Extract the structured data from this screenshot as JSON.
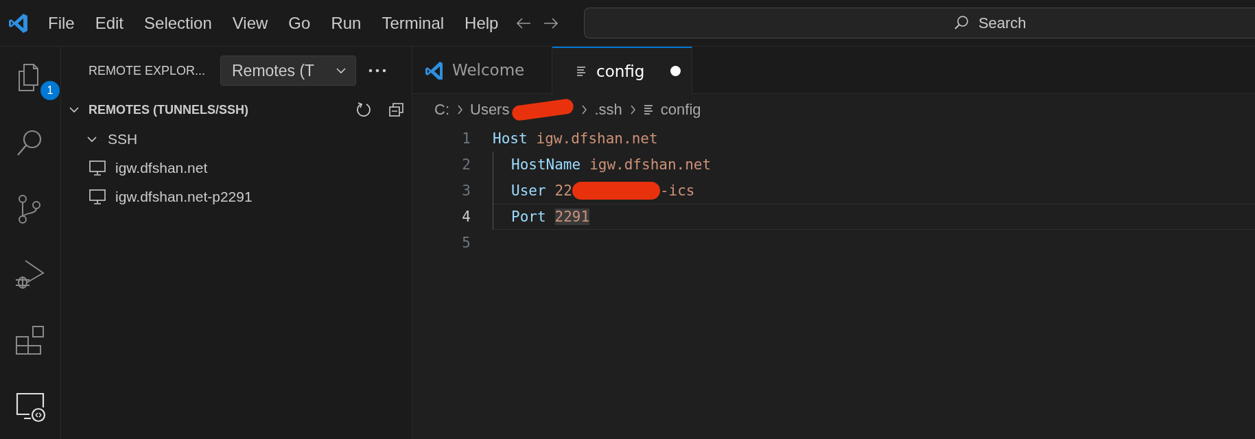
{
  "title_bar": {
    "menu": [
      "File",
      "Edit",
      "Selection",
      "View",
      "Go",
      "Run",
      "Terminal",
      "Help"
    ],
    "search": {
      "placeholder": "Search"
    }
  },
  "activity_bar": {
    "items": [
      {
        "kind": "explorer",
        "selected": false,
        "badge": "1"
      },
      {
        "kind": "search",
        "selected": false
      },
      {
        "kind": "source-control",
        "selected": false
      },
      {
        "kind": "run-debug",
        "selected": false
      },
      {
        "kind": "extensions",
        "selected": false
      },
      {
        "kind": "remote-explorer",
        "selected": true
      }
    ]
  },
  "sidebar": {
    "title": "REMOTE EXPLOR...",
    "dropdown": "Remotes (T",
    "section": {
      "title": "REMOTES (TUNNELS/SSH)",
      "expanded": true,
      "children": [
        {
          "label": "SSH",
          "expanded": true,
          "children": [
            {
              "label": "igw.dfshan.net"
            },
            {
              "label": "igw.dfshan.net-p2291"
            }
          ]
        }
      ]
    }
  },
  "tabs": [
    {
      "label": "Welcome",
      "kind": "welcome",
      "selected": false,
      "modified": false
    },
    {
      "label": "config",
      "kind": "file",
      "selected": true,
      "modified": true
    }
  ],
  "breadcrumbs": [
    {
      "kind": "text",
      "label": "C:"
    },
    {
      "kind": "text",
      "label": "Users"
    },
    {
      "kind": "redaction"
    },
    {
      "kind": "text",
      "label": ".ssh"
    },
    {
      "kind": "file",
      "label": "config"
    }
  ],
  "code": [
    {
      "number": "1",
      "indented": false,
      "current": false,
      "tokens": [
        {
          "kind": "keyword",
          "text": "Host"
        },
        {
          "kind": "value",
          "text": "igw.dfshan.net"
        }
      ]
    },
    {
      "number": "2",
      "indented": true,
      "current": false,
      "tokens": [
        {
          "kind": "keyword",
          "text": "HostName"
        },
        {
          "kind": "value",
          "text": "igw.dfshan.net"
        }
      ]
    },
    {
      "number": "3",
      "indented": true,
      "current": false,
      "tokens": [
        {
          "kind": "keyword",
          "text": "User"
        },
        {
          "kind": "value",
          "text": "22"
        },
        {
          "kind": "redaction"
        },
        {
          "kind": "value",
          "text": "-ics"
        }
      ]
    },
    {
      "number": "4",
      "indented": true,
      "current": true,
      "tokens": [
        {
          "kind": "keyword",
          "text": "Port"
        },
        {
          "kind": "value",
          "text": "2291",
          "highlighted": true
        }
      ]
    },
    {
      "number": "5",
      "indented": false,
      "current": false
    }
  ]
}
